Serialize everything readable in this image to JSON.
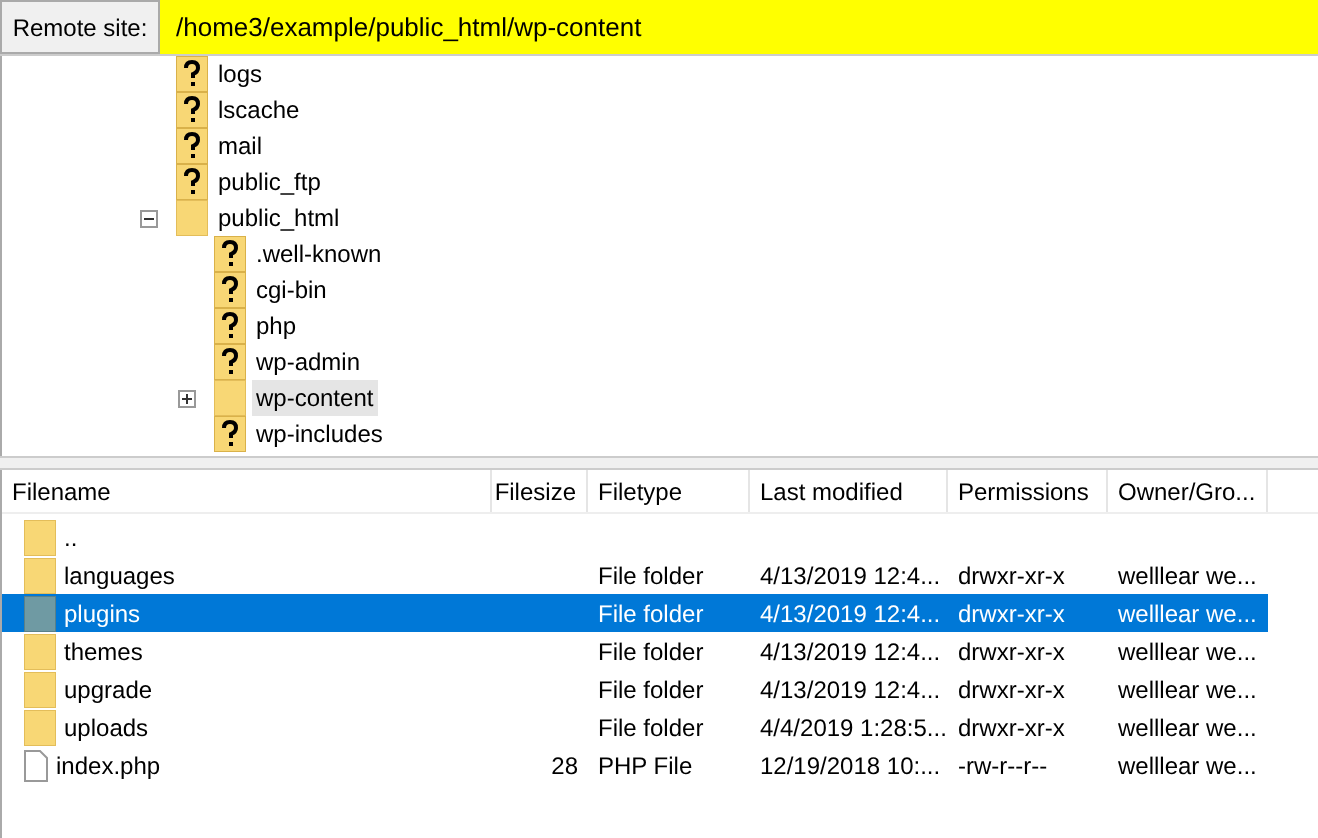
{
  "remote_site": {
    "label": "Remote site:",
    "path": "/home3/example/public_html/wp-content"
  },
  "tree": [
    {
      "name": "logs",
      "kind": "unknown",
      "selected": false
    },
    {
      "name": "lscache",
      "kind": "unknown",
      "selected": false
    },
    {
      "name": "mail",
      "kind": "unknown",
      "selected": false
    },
    {
      "name": "public_ftp",
      "kind": "unknown",
      "selected": false
    },
    {
      "name": "public_html",
      "kind": "folder",
      "selected": false,
      "expanded": true,
      "children": [
        {
          "name": ".well-known",
          "kind": "unknown",
          "selected": false
        },
        {
          "name": "cgi-bin",
          "kind": "unknown",
          "selected": false
        },
        {
          "name": "php",
          "kind": "unknown",
          "selected": false
        },
        {
          "name": "wp-admin",
          "kind": "unknown",
          "selected": false
        },
        {
          "name": "wp-content",
          "kind": "folder",
          "selected": true,
          "expanded": false
        },
        {
          "name": "wp-includes",
          "kind": "unknown",
          "selected": false
        }
      ]
    }
  ],
  "table": {
    "columns": [
      "Filename",
      "Filesize",
      "Filetype",
      "Last modified",
      "Permissions",
      "Owner/Gro..."
    ],
    "rows": [
      {
        "kind": "folder",
        "selected": false,
        "cells": [
          "..",
          "",
          "",
          "",
          "",
          ""
        ]
      },
      {
        "kind": "folder",
        "selected": false,
        "cells": [
          "languages",
          "",
          "File folder",
          "4/13/2019 12:4...",
          "drwxr-xr-x",
          "welllear we..."
        ]
      },
      {
        "kind": "folder",
        "selected": true,
        "cells": [
          "plugins",
          "",
          "File folder",
          "4/13/2019 12:4...",
          "drwxr-xr-x",
          "welllear we..."
        ]
      },
      {
        "kind": "folder",
        "selected": false,
        "cells": [
          "themes",
          "",
          "File folder",
          "4/13/2019 12:4...",
          "drwxr-xr-x",
          "welllear we..."
        ]
      },
      {
        "kind": "folder",
        "selected": false,
        "cells": [
          "upgrade",
          "",
          "File folder",
          "4/13/2019 12:4...",
          "drwxr-xr-x",
          "welllear we..."
        ]
      },
      {
        "kind": "folder",
        "selected": false,
        "cells": [
          "uploads",
          "",
          "File folder",
          "4/4/2019 1:28:5...",
          "drwxr-xr-x",
          "welllear we..."
        ]
      },
      {
        "kind": "file",
        "selected": false,
        "cells": [
          "index.php",
          "28",
          "PHP File",
          "12/19/2018 10:...",
          "-rw-r--r--",
          "welllear we..."
        ]
      }
    ]
  }
}
